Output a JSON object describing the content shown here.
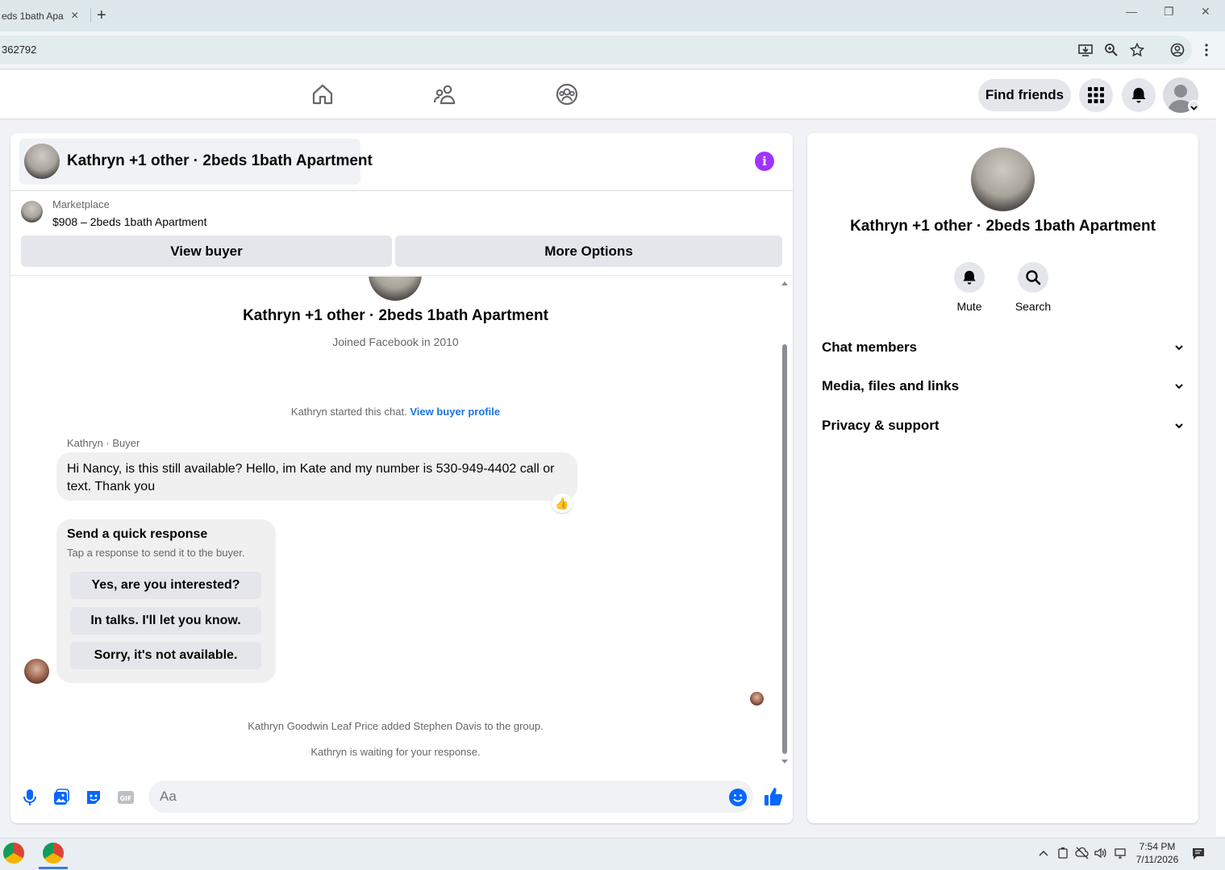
{
  "browser": {
    "tab_title": "eds 1bath Apa",
    "tab_close": "×",
    "new_tab": "+",
    "url": "362792",
    "win_minimize": "—",
    "win_restore": "❐",
    "win_close": "✕"
  },
  "header": {
    "find_friends": "Find friends"
  },
  "chat": {
    "title": "Kathryn +1 other · 2beds 1bath Apartment",
    "info_glyph": "i",
    "marketplace_label": "Marketplace",
    "listing": "$908 – 2beds 1bath Apartment",
    "view_buyer": "View buyer",
    "more_options": "More Options",
    "profile_name": "Kathryn +1 other · 2beds 1bath Apartment",
    "joined": "Joined Facebook in 2010",
    "started_text": "Kathryn started this chat.",
    "view_buyer_profile": "View buyer profile",
    "sender": "Kathryn · Buyer",
    "message": "Hi Nancy, is this still available? Hello, im Kate and my number is 530-949-4402 call or text. Thank you",
    "reaction": "👍",
    "quick_title": "Send a quick response",
    "quick_sub": "Tap a response to send it to the buyer.",
    "quick_replies": [
      "Yes, are you interested?",
      "In talks. I'll let you know.",
      "Sorry, it's not available."
    ],
    "added_notice": "Kathryn Goodwin Leaf Price added Stephen Davis to the group.",
    "waiting_notice": "Kathryn is waiting for your response.",
    "composer_placeholder": "Aa"
  },
  "details": {
    "name": "Kathryn +1 other · 2beds 1bath Apartment",
    "mute": "Mute",
    "search": "Search",
    "sections": [
      "Chat members",
      "Media, files and links",
      "Privacy & support"
    ]
  },
  "taskbar": {
    "time": "7:54 PM",
    "date": "7/11/2026"
  },
  "colors": {
    "accent_blue": "#1b74e4",
    "info_purple": "#a033ff",
    "bubble_gray": "#f0f0f0"
  }
}
